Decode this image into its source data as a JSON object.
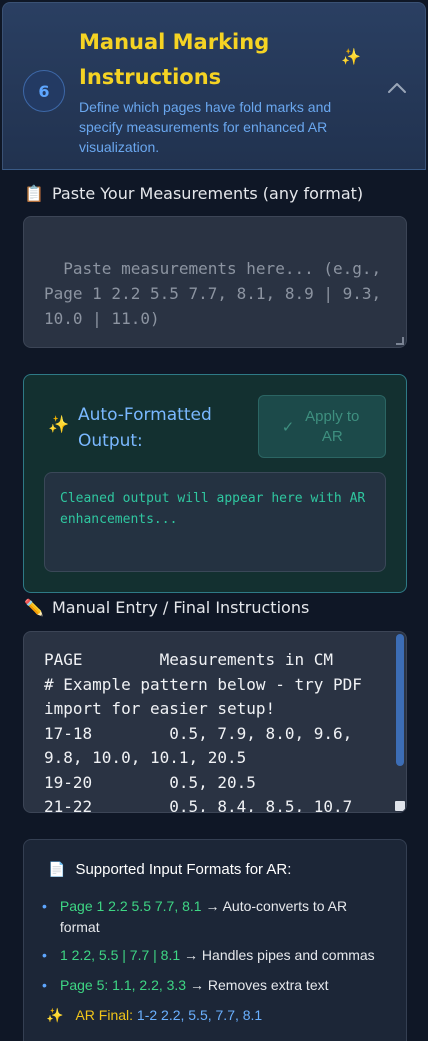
{
  "header": {
    "step_number": "6",
    "title": "Manual Marking Instructions",
    "description": "Define which pages have fold marks and specify measurements for enhanced AR visualization.",
    "sparkle_icon": "sparkle-icon",
    "collapse_icon": "chevron-up-icon"
  },
  "paste_section": {
    "icon": "clipboard-icon",
    "label": "Paste Your Measurements (any format)",
    "placeholder": "Paste measurements here... (e.g., Page 1 2.2 5.5 7.7, 8.1, 8.9 | 9.3, 10.0 | 11.0)",
    "value": ""
  },
  "auto_format": {
    "icon": "sparkle-icon",
    "title": "Auto-Formatted Output:",
    "apply_check_icon": "check-icon",
    "apply_label": "Apply to AR",
    "output_placeholder": "Cleaned output will appear here with AR enhancements..."
  },
  "manual_section": {
    "icon": "pencil-icon",
    "label": "Manual Entry / Final Instructions",
    "value": "PAGE        Measurements in CM\n# Example pattern below - try PDF import for easier setup!\n17-18        0.5, 7.9, 8.0, 9.6, 9.8, 10.0, 10.1, 20.5\n19-20        0.5, 20.5\n21-22        0.5, 8.4, 8.5, 10.7"
  },
  "formats": {
    "icon": "document-icon",
    "title": "Supported Input Formats for AR:",
    "items": [
      {
        "example": "Page 1 2.2 5.5 7.7, 8.1",
        "desc": " → Auto-converts to AR format"
      },
      {
        "example": "1 2.2, 5.5 | 7.7 | 8.1",
        "desc": " → Handles pipes and commas"
      },
      {
        "example": "Page 5: 1.1, 2.2, 3.3",
        "desc": " → Removes extra text"
      }
    ],
    "final_icon": "sparkle-icon",
    "final_label": "AR Final: ",
    "final_example": "1-2 2.2, 5.5, 7.7, 8.1"
  },
  "colors": {
    "accent_title": "#f5d323",
    "link_blue": "#6aa7ef",
    "success_green": "#3ed684",
    "panel_teal": "#133030"
  }
}
